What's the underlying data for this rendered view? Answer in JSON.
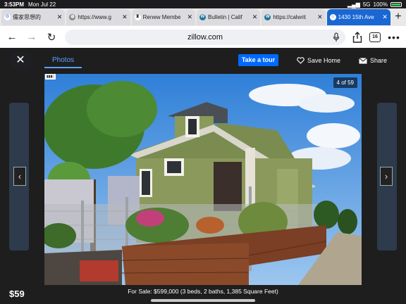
{
  "status_bar": {
    "time": "3:53PM",
    "date": "Mon Jul 22",
    "signal": "5G",
    "battery": "100%"
  },
  "tabs": [
    {
      "title": "儒家思想的",
      "favicon": "google-icon",
      "color": "#4285f4"
    },
    {
      "title": "https://www.g",
      "favicon": "globe-icon",
      "color": "#555555"
    },
    {
      "title": "Renew Membe",
      "favicon": "crest-icon",
      "color": "#333333"
    },
    {
      "title": "Bulletin | Calif",
      "favicon": "wordpress-icon",
      "color": "#21759b"
    },
    {
      "title": "https://calwrit",
      "favicon": "wordpress-icon",
      "color": "#21759b"
    },
    {
      "title": "1430 15th Ave",
      "favicon": "zillow-icon",
      "color": "#ffffff",
      "active": true
    }
  ],
  "toolbar": {
    "url": "zillow.com",
    "tab_count": "16"
  },
  "modal": {
    "photos_tab": "Photos",
    "take_tour": "Take a tour",
    "save_home": "Save Home",
    "share": "Share",
    "photo_counter": "4 of 59",
    "caption": "For Sale: $599,000 (3 beds, 2 baths, 1,385 Square Feet)",
    "background_price": "$59"
  },
  "colors": {
    "accent": "#006aff",
    "active_tab": "#1967d2",
    "photos_tab": "#5aa0ff"
  }
}
